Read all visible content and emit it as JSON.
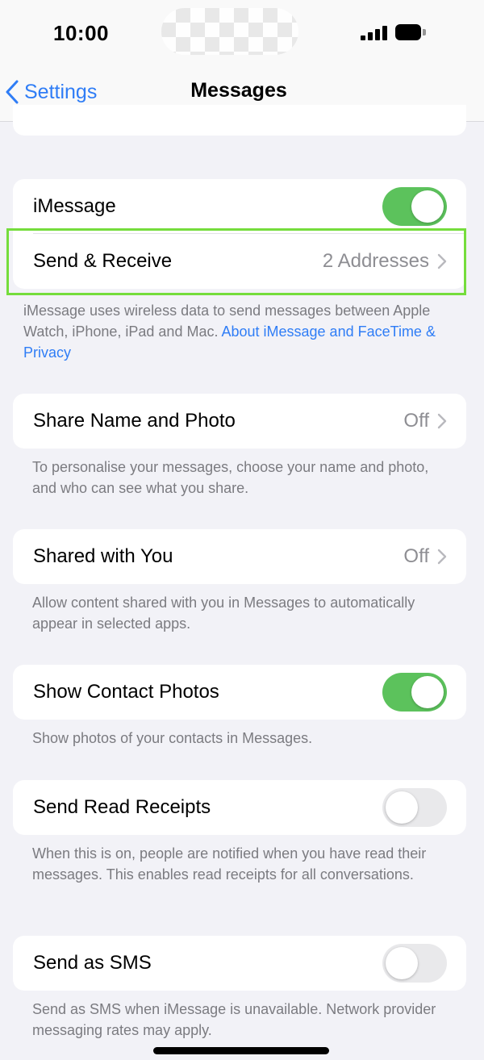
{
  "status_bar": {
    "time": "10:00",
    "icons": [
      "signal-icon",
      "battery-icon"
    ]
  },
  "nav": {
    "back_label": "Settings",
    "title": "Messages",
    "back_icon": "chevron-left-icon"
  },
  "sections": {
    "imessage": {
      "toggle_label": "iMessage",
      "toggle_on": true,
      "send_receive_label": "Send & Receive",
      "send_receive_value": "2 Addresses",
      "footer_text": "iMessage uses wireless data to send messages between Apple Watch, iPhone, iPad and Mac.",
      "footer_link": "About iMessage and FaceTime & Privacy"
    },
    "share_name": {
      "label": "Share Name and Photo",
      "value": "Off",
      "footer": "To personalise your messages, choose your name and photo, and who can see what you share."
    },
    "shared_with_you": {
      "label": "Shared with You",
      "value": "Off",
      "footer": "Allow content shared with you in Messages to automatically appear in selected apps."
    },
    "contact_photos": {
      "label": "Show Contact Photos",
      "toggle_on": true,
      "footer": "Show photos of your contacts in Messages."
    },
    "read_receipts": {
      "label": "Send Read Receipts",
      "toggle_on": false,
      "footer": "When this is on, people are notified when you have read their messages. This enables read receipts for all conversations."
    },
    "send_as_sms": {
      "label": "Send as SMS",
      "toggle_on": false,
      "footer": "Send as SMS when iMessage is unavailable. Network provider messaging rates may apply."
    }
  },
  "colors": {
    "accent": "#2f7df6",
    "toggle_on": "#5cc25c",
    "highlight": "#75dd3c",
    "background": "#f2f2f7"
  }
}
